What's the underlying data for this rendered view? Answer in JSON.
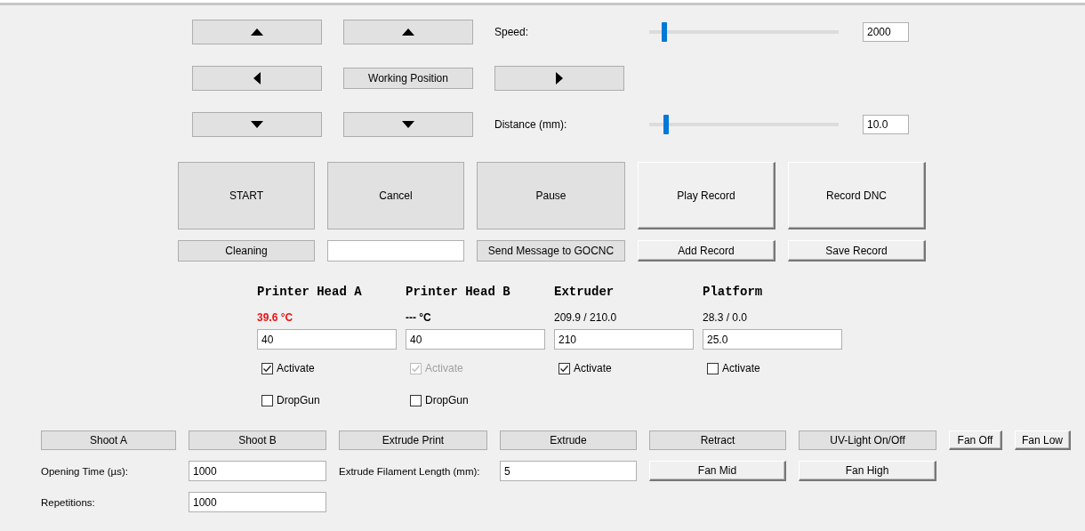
{
  "jog_rows": [
    [
      {
        "kind": "up"
      },
      {
        "kind": "up"
      }
    ],
    [
      {
        "kind": "left"
      },
      {
        "kind": "text",
        "label": "Working Position"
      },
      {
        "kind": "right"
      }
    ],
    [
      {
        "kind": "down"
      },
      {
        "kind": "down"
      }
    ]
  ],
  "sliders": [
    {
      "label": "Speed:",
      "level": 0.08,
      "value": "2000"
    },
    {
      "label": "Distance (mm):",
      "level": 0.09,
      "value": "10.0"
    }
  ],
  "actions": [
    {
      "label": "START",
      "kind": "flat"
    },
    {
      "label": "Cancel",
      "kind": "flat"
    },
    {
      "label": "Pause",
      "kind": "flat"
    },
    {
      "label": "Play Record",
      "kind": "raised"
    },
    {
      "label": "Record DNC",
      "kind": "raised"
    }
  ],
  "action_row2": [
    {
      "kind": "flat",
      "label": "Cleaning"
    },
    {
      "kind": "field"
    },
    {
      "kind": "flat",
      "label": "Send Message to GOCNC"
    },
    {
      "kind": "raised",
      "label": "Add Record"
    },
    {
      "kind": "raised",
      "label": "Save Record"
    }
  ],
  "heaters": [
    {
      "name": "Printer Head A",
      "reading": "39.6 °C",
      "kind": "alert",
      "value": "40",
      "activate": {
        "label": "Activate",
        "checked": true,
        "disabled": false
      },
      "dropgun": {
        "label": "DropGun",
        "checked": false
      }
    },
    {
      "name": "Printer Head B",
      "reading": "--- °C",
      "kind": "bold",
      "value": "40",
      "activate": {
        "label": "Activate",
        "checked": true,
        "disabled": true
      },
      "dropgun": {
        "label": "DropGun",
        "checked": false
      }
    },
    {
      "name": "Extruder",
      "reading": "209.9 / 210.0",
      "kind": "normal",
      "value": "210",
      "activate": {
        "label": "Activate",
        "checked": true,
        "disabled": false
      }
    },
    {
      "name": "Platform",
      "reading": "28.3 / 0.0",
      "kind": "normal",
      "value": "25.0",
      "activate": {
        "label": "Activate",
        "checked": false,
        "disabled": false
      }
    }
  ],
  "tool_rows": [
    [
      {
        "kind": "flat",
        "label": "Shoot A"
      },
      {
        "kind": "flat",
        "label": "Shoot B"
      },
      {
        "kind": "flat",
        "label": "Extrude Print"
      },
      {
        "kind": "flat",
        "label": "Extrude"
      },
      {
        "kind": "flat",
        "label": "Retract"
      },
      {
        "kind": "flat",
        "label": "UV-Light On/Off"
      },
      {
        "kind": "raised",
        "label": "Fan Off"
      },
      {
        "kind": "raised",
        "label": "Fan Low"
      }
    ],
    [
      {
        "kind": "label",
        "label": "Opening Time (µs):"
      },
      {
        "kind": "field",
        "value": "1000"
      },
      {
        "kind": "label",
        "label": "Extrude Filament Length (mm):"
      },
      {
        "kind": "field",
        "value": "5"
      },
      {
        "kind": "raised",
        "label": "Fan Mid"
      },
      {
        "kind": "raised",
        "label": "Fan High"
      }
    ],
    [
      {
        "kind": "label",
        "label": "Repetitions:"
      },
      {
        "kind": "field",
        "value": "1000"
      }
    ]
  ]
}
